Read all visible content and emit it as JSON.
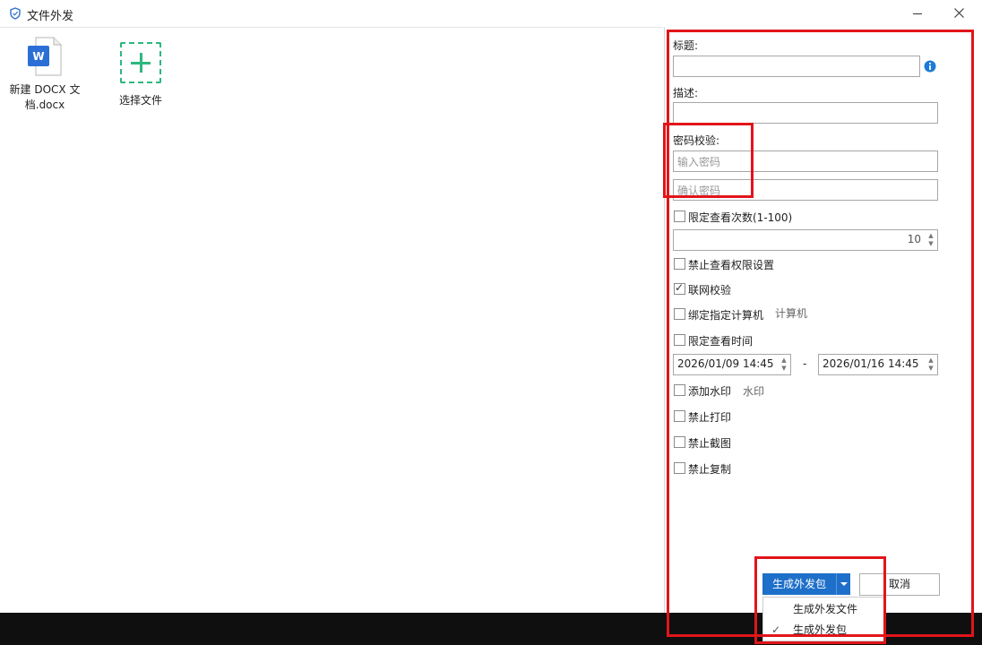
{
  "window": {
    "title": "文件外发"
  },
  "files": [
    {
      "name": "新建 DOCX 文档.docx",
      "name_line1": "新建 DOCX 文",
      "name_line2": "档.docx",
      "icon": "word-doc-icon"
    },
    {
      "name": "选择文件",
      "icon": "add-file-icon"
    }
  ],
  "form": {
    "title_label": "标题:",
    "desc_label": "描述:",
    "password_label": "密码校验:",
    "password_placeholder": "输入密码",
    "confirm_placeholder": "确认密码",
    "limit_views_label": "限定查看次数(1-100)",
    "limit_views_value": "10",
    "forbid_perm_label": "禁止查看权限设置",
    "online_check_label": "联网校验",
    "bind_pc_label": "绑定指定计算机",
    "bind_pc_sub": "计算机",
    "limit_time_label": "限定查看时间",
    "time_start": "2026/01/09 14:45",
    "time_sep": "-",
    "time_end": "2026/01/16 14:45",
    "watermark_label": "添加水印",
    "watermark_sub": "水印",
    "forbid_print_label": "禁止打印",
    "forbid_screenshot_label": "禁止截图",
    "forbid_copy_label": "禁止复制"
  },
  "checkboxes": {
    "limit_views": false,
    "forbid_perm": false,
    "online_check": true,
    "bind_pc": false,
    "limit_time": false,
    "watermark": false,
    "forbid_print": false,
    "forbid_screenshot": false,
    "forbid_copy": false
  },
  "buttons": {
    "generate": "生成外发包",
    "cancel": "取消"
  },
  "menu": {
    "items": [
      "生成外发文件",
      "生成外发包"
    ],
    "checked_index": 1
  },
  "colors": {
    "primary": "#1e6fc9",
    "accent_green": "#2db87d",
    "annotation_red": "#e1151a"
  }
}
